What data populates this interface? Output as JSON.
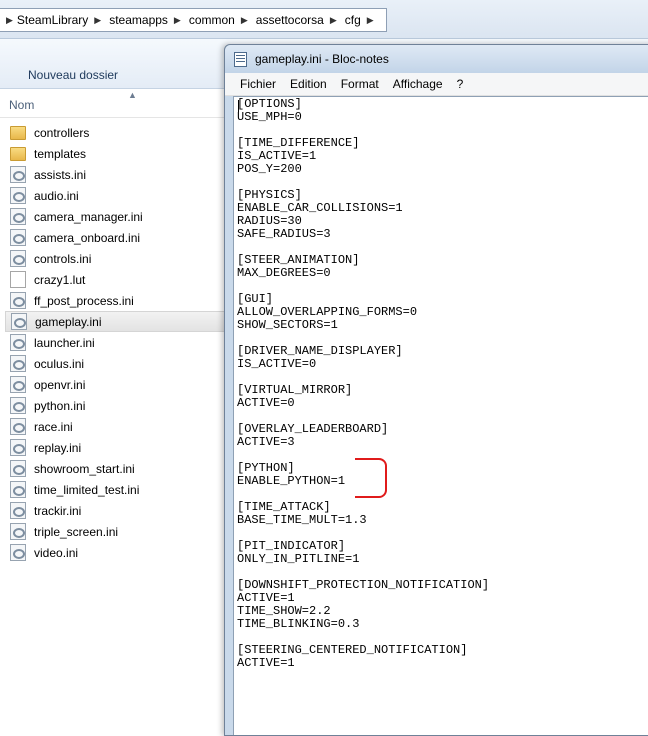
{
  "breadcrumb": [
    "SteamLibrary",
    "steamapps",
    "common",
    "assettocorsa",
    "cfg"
  ],
  "toolbar": {
    "new_folder": "Nouveau dossier"
  },
  "columns": {
    "name": "Nom"
  },
  "files": [
    {
      "name": "controllers",
      "icon": "folder-icon"
    },
    {
      "name": "templates",
      "icon": "folder-icon"
    },
    {
      "name": "assists.ini",
      "icon": "ini-file-icon"
    },
    {
      "name": "audio.ini",
      "icon": "ini-file-icon"
    },
    {
      "name": "camera_manager.ini",
      "icon": "ini-file-icon"
    },
    {
      "name": "camera_onboard.ini",
      "icon": "ini-file-icon"
    },
    {
      "name": "controls.ini",
      "icon": "ini-file-icon"
    },
    {
      "name": "crazy1.lut",
      "icon": "file-icon"
    },
    {
      "name": "ff_post_process.ini",
      "icon": "ini-file-icon"
    },
    {
      "name": "gameplay.ini",
      "icon": "ini-file-icon",
      "selected": true
    },
    {
      "name": "launcher.ini",
      "icon": "ini-file-icon"
    },
    {
      "name": "oculus.ini",
      "icon": "ini-file-icon"
    },
    {
      "name": "openvr.ini",
      "icon": "ini-file-icon"
    },
    {
      "name": "python.ini",
      "icon": "ini-file-icon"
    },
    {
      "name": "race.ini",
      "icon": "ini-file-icon"
    },
    {
      "name": "replay.ini",
      "icon": "ini-file-icon"
    },
    {
      "name": "showroom_start.ini",
      "icon": "ini-file-icon"
    },
    {
      "name": "time_limited_test.ini",
      "icon": "ini-file-icon"
    },
    {
      "name": "trackir.ini",
      "icon": "ini-file-icon"
    },
    {
      "name": "triple_screen.ini",
      "icon": "ini-file-icon"
    },
    {
      "name": "video.ini",
      "icon": "ini-file-icon"
    }
  ],
  "notepad": {
    "title": "gameplay.ini - Bloc-notes",
    "menu": [
      "Fichier",
      "Edition",
      "Format",
      "Affichage",
      "?"
    ],
    "content": "[OPTIONS]\nUSE_MPH=0\n\n[TIME_DIFFERENCE]\nIS_ACTIVE=1\nPOS_Y=200\n\n[PHYSICS]\nENABLE_CAR_COLLISIONS=1\nRADIUS=30\nSAFE_RADIUS=3\n\n[STEER_ANIMATION]\nMAX_DEGREES=0\n\n[GUI]\nALLOW_OVERLAPPING_FORMS=0\nSHOW_SECTORS=1\n\n[DRIVER_NAME_DISPLAYER]\nIS_ACTIVE=0\n\n[VIRTUAL_MIRROR]\nACTIVE=0\n\n[OVERLAY_LEADERBOARD]\nACTIVE=3\n\n[PYTHON]\nENABLE_PYTHON=1\n\n[TIME_ATTACK]\nBASE_TIME_MULT=1.3\n\n[PIT_INDICATOR]\nONLY_IN_PITLINE=1\n\n[DOWNSHIFT_PROTECTION_NOTIFICATION]\nACTIVE=1\nTIME_SHOW=2.2\nTIME_BLINKING=0.3\n\n[STEERING_CENTERED_NOTIFICATION]\nACTIVE=1"
  },
  "colors": {
    "annotation": "#e01b1b",
    "selection": "#e3e3e3"
  }
}
